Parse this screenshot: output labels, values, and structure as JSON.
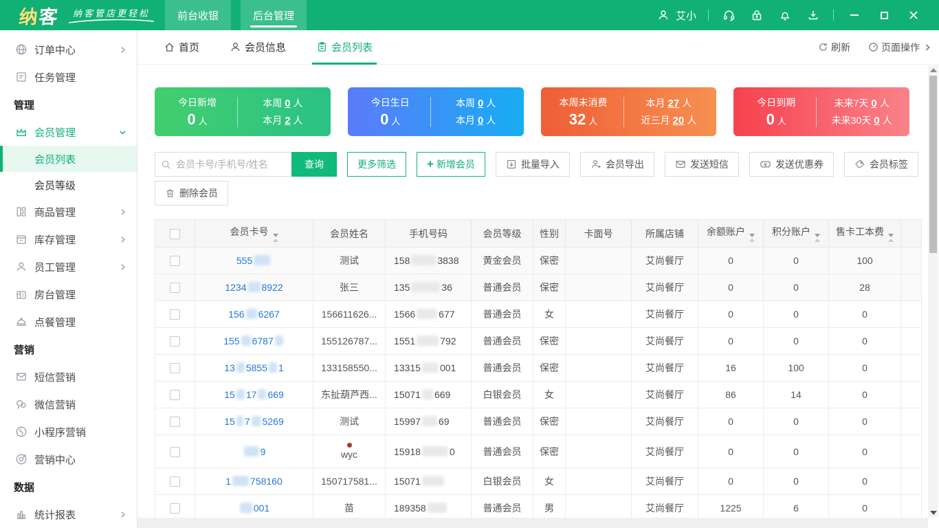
{
  "header": {
    "logo": "纳客",
    "slogan": "纳客管店更轻松",
    "nav": [
      {
        "label": "前台收银"
      },
      {
        "label": "后台管理"
      }
    ],
    "user": "艾小"
  },
  "tabbar": {
    "tabs": [
      {
        "label": "首页"
      },
      {
        "label": "会员信息"
      },
      {
        "label": "会员列表"
      }
    ],
    "refresh": "刷新",
    "page_ops": "页面操作"
  },
  "sidebar": {
    "items": [
      {
        "kind": "item",
        "icon": "globe",
        "label": "订单中心",
        "chevron": "right"
      },
      {
        "kind": "item",
        "icon": "task",
        "label": "任务管理"
      },
      {
        "kind": "section",
        "label": "管理"
      },
      {
        "kind": "item",
        "icon": "crown",
        "label": "会员管理",
        "chevron": "down",
        "green": true
      },
      {
        "kind": "sub",
        "label": "会员列表",
        "selected": true
      },
      {
        "kind": "sub",
        "label": "会员等级"
      },
      {
        "kind": "item",
        "icon": "goods",
        "label": "商品管理",
        "chevron": "right"
      },
      {
        "kind": "item",
        "icon": "stock",
        "label": "库存管理",
        "chevron": "right"
      },
      {
        "kind": "item",
        "icon": "staff",
        "label": "员工管理",
        "chevron": "right"
      },
      {
        "kind": "item",
        "icon": "room",
        "label": "房台管理"
      },
      {
        "kind": "item",
        "icon": "dish",
        "label": "点餐管理"
      },
      {
        "kind": "section",
        "label": "营销"
      },
      {
        "kind": "item",
        "icon": "sms",
        "label": "短信营销"
      },
      {
        "kind": "item",
        "icon": "wechat",
        "label": "微信营销"
      },
      {
        "kind": "item",
        "icon": "miniapp",
        "label": "小程序营销"
      },
      {
        "kind": "item",
        "icon": "target",
        "label": "营销中心"
      },
      {
        "kind": "section",
        "label": "数据"
      },
      {
        "kind": "item",
        "icon": "chart",
        "label": "统计报表",
        "chevron": "right"
      }
    ]
  },
  "cards": [
    {
      "title": "今日新增",
      "value": "0",
      "unit": "人",
      "gradient": [
        "#43ce6e",
        "#2bc186"
      ],
      "stats": [
        {
          "label": "本周",
          "value": "0",
          "unit": "人"
        },
        {
          "label": "本月",
          "value": "2",
          "unit": "人"
        }
      ]
    },
    {
      "title": "今日生日",
      "value": "0",
      "unit": "人",
      "gradient": [
        "#5b7bfa",
        "#17adf2"
      ],
      "stats": [
        {
          "label": "本周",
          "value": "0",
          "unit": "人"
        },
        {
          "label": "本月",
          "value": "0",
          "unit": "人"
        }
      ]
    },
    {
      "title": "本周未消费",
      "value": "32",
      "unit": "人",
      "gradient": [
        "#ee5e36",
        "#f79051"
      ],
      "stats": [
        {
          "label": "本月",
          "value": "27",
          "unit": "人"
        },
        {
          "label": "近三月",
          "value": "20",
          "unit": "人"
        }
      ]
    },
    {
      "title": "今日到期",
      "value": "0",
      "unit": "人",
      "gradient": [
        "#f5424e",
        "#fb8289"
      ],
      "stats": [
        {
          "label": "未来7天",
          "value": "0",
          "unit": "人"
        },
        {
          "label": "未来30天",
          "value": "0",
          "unit": "人"
        }
      ]
    }
  ],
  "toolbar": {
    "search_placeholder": "会员卡号/手机号/姓名",
    "query": "查询",
    "more_filter": "更多筛选",
    "add_member": "新增会员",
    "batch_import": "批量导入",
    "export_member": "会员导出",
    "send_sms": "发送短信",
    "send_coupon": "发送优惠券",
    "member_tag": "会员标签",
    "delete_member": "删除会员"
  },
  "table": {
    "columns": [
      {
        "label": "",
        "type": "checkbox"
      },
      {
        "label": "会员卡号",
        "sort": true
      },
      {
        "label": "会员姓名"
      },
      {
        "label": "手机号码"
      },
      {
        "label": "会员等级"
      },
      {
        "label": "性别"
      },
      {
        "label": "卡面号"
      },
      {
        "label": "所属店铺"
      },
      {
        "label": "余额账户",
        "sort": true
      },
      {
        "label": "积分账户",
        "sort": true
      },
      {
        "label": "售卡工本费",
        "sort": true
      },
      {
        "label": ""
      }
    ],
    "rows": [
      {
        "shade": true,
        "card": [
          {
            "t": "555"
          },
          {
            "b": 24,
            "c": "blue"
          }
        ],
        "name": "测试",
        "phone": [
          {
            "t": "158"
          },
          {
            "b": 36,
            "c": "gray"
          },
          {
            "t": "3838"
          }
        ],
        "grade": "黄金会员",
        "gender": "保密",
        "face": "",
        "shop": "艾尚餐厅",
        "balance": "0",
        "points": "0",
        "fee": "100"
      },
      {
        "shade": true,
        "card": [
          {
            "t": "1234"
          },
          {
            "b": 18,
            "c": "blue"
          },
          {
            "t": "8922"
          }
        ],
        "name": "张三",
        "phone": [
          {
            "t": "135"
          },
          {
            "b": 42,
            "c": "gray"
          },
          {
            "t": "36"
          }
        ],
        "grade": "普通会员",
        "gender": "保密",
        "face": "",
        "shop": "艾尚餐厅",
        "balance": "0",
        "points": "0",
        "fee": "28"
      },
      {
        "card": [
          {
            "t": "156"
          },
          {
            "b": 16,
            "c": "blue"
          },
          {
            "t": "6267"
          }
        ],
        "name": "156611626...",
        "phone": [
          {
            "t": "1566"
          },
          {
            "b": 30,
            "c": "gray"
          },
          {
            "t": "677"
          }
        ],
        "grade": "普通会员",
        "gender": "女",
        "face": "",
        "shop": "艾尚餐厅",
        "balance": "0",
        "points": "0",
        "fee": "0"
      },
      {
        "card": [
          {
            "t": "155"
          },
          {
            "b": 14,
            "c": "blue"
          },
          {
            "t": "6787"
          },
          {
            "b": 12,
            "c": "blue"
          }
        ],
        "name": "155126787...",
        "phone": [
          {
            "t": "1551"
          },
          {
            "b": 32,
            "c": "gray"
          },
          {
            "t": "792"
          }
        ],
        "grade": "普通会员",
        "gender": "保密",
        "face": "",
        "shop": "艾尚餐厅",
        "balance": "0",
        "points": "0",
        "fee": "0"
      },
      {
        "card": [
          {
            "t": "13"
          },
          {
            "b": 12,
            "c": "blue"
          },
          {
            "t": "5855"
          },
          {
            "b": 12,
            "c": "blue"
          },
          {
            "t": "1"
          }
        ],
        "name": "133158550...",
        "phone": [
          {
            "t": "13315"
          },
          {
            "b": 24,
            "c": "gray"
          },
          {
            "t": "001"
          }
        ],
        "grade": "普通会员",
        "gender": "保密",
        "face": "",
        "shop": "艾尚餐厅",
        "balance": "16",
        "points": "100",
        "fee": "0"
      },
      {
        "card": [
          {
            "t": "15"
          },
          {
            "b": 12,
            "c": "blue"
          },
          {
            "t": "17"
          },
          {
            "b": 12,
            "c": "blue"
          },
          {
            "t": "669"
          }
        ],
        "name": "东扯葫芦西...",
        "phone": [
          {
            "t": "15071"
          },
          {
            "b": 16,
            "c": "gray"
          },
          {
            "t": "669"
          }
        ],
        "grade": "白银会员",
        "gender": "女",
        "face": "",
        "shop": "艾尚餐厅",
        "balance": "86",
        "points": "14",
        "fee": "0"
      },
      {
        "card": [
          {
            "t": "15"
          },
          {
            "b": 10,
            "c": "blue"
          },
          {
            "t": "7"
          },
          {
            "b": 14,
            "c": "blue"
          },
          {
            "t": "5269"
          }
        ],
        "name": "测试",
        "phone": [
          {
            "t": "15997"
          },
          {
            "b": 22,
            "c": "gray"
          },
          {
            "t": "69"
          }
        ],
        "grade": "普通会员",
        "gender": "保密",
        "face": "",
        "shop": "艾尚餐厅",
        "balance": "0",
        "points": "0",
        "fee": "0"
      },
      {
        "tall": true,
        "dot": true,
        "card": [
          {
            "b": 22,
            "c": "blue"
          },
          {
            "t": "9"
          }
        ],
        "name": "wyc",
        "phone": [
          {
            "t": "15918"
          },
          {
            "b": 38,
            "c": "gray"
          },
          {
            "t": "0"
          }
        ],
        "grade": "普通会员",
        "gender": "保密",
        "face": "",
        "shop": "艾尚餐厅",
        "balance": "0",
        "points": "0",
        "fee": "0"
      },
      {
        "card": [
          {
            "t": "1"
          },
          {
            "b": 24,
            "c": "blue"
          },
          {
            "t": "758160"
          }
        ],
        "name": "150717581...",
        "phone": [
          {
            "t": "15071"
          },
          {
            "b": 32,
            "c": "gray"
          }
        ],
        "grade": "白银会员",
        "gender": "女",
        "face": "",
        "shop": "艾尚餐厅",
        "balance": "0",
        "points": "0",
        "fee": "0"
      },
      {
        "card": [
          {
            "b": 18,
            "c": "blue"
          },
          {
            "t": "001"
          }
        ],
        "name": "苗",
        "phone": [
          {
            "t": "189358"
          },
          {
            "b": 28,
            "c": "gray"
          }
        ],
        "grade": "普通会员",
        "gender": "男",
        "face": "",
        "shop": "艾尚餐厅",
        "balance": "1225",
        "points": "6",
        "fee": "0"
      }
    ]
  },
  "colors": {
    "primary": "#11b176"
  }
}
